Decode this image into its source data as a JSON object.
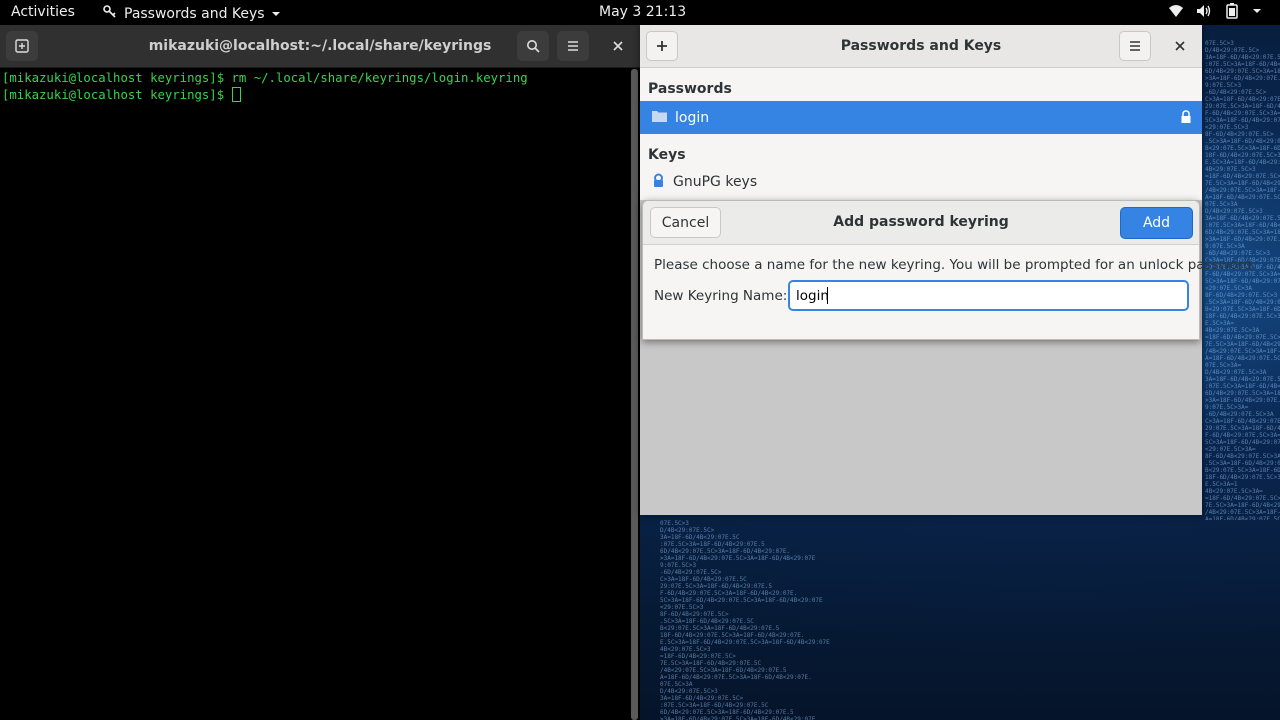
{
  "topbar": {
    "activities": "Activities",
    "app_name": "Passwords and Keys",
    "clock": "May 3  21:13"
  },
  "terminal": {
    "title": "mikazuki@localhost:~/.local/share/keyrings",
    "lines": [
      "[mikazuki@localhost keyrings]$ rm ~/.local/share/keyrings/login.keyring",
      "[mikazuki@localhost keyrings]$ "
    ],
    "text_color": "#3ad34a"
  },
  "seahorse": {
    "title": "Passwords and Keys",
    "passwords_heading": "Passwords",
    "passwords_items": [
      "login"
    ],
    "keys_heading": "Keys",
    "keys_items": [
      "GnuPG keys"
    ],
    "accent": "#3584e4"
  },
  "dialog": {
    "title": "Add password keyring",
    "cancel_label": "Cancel",
    "add_label": "Add",
    "message": "Please choose a name for the new keyring. You will be prompted for an unlock password.",
    "name_label": "New Keyring Name:",
    "name_value": "login"
  }
}
